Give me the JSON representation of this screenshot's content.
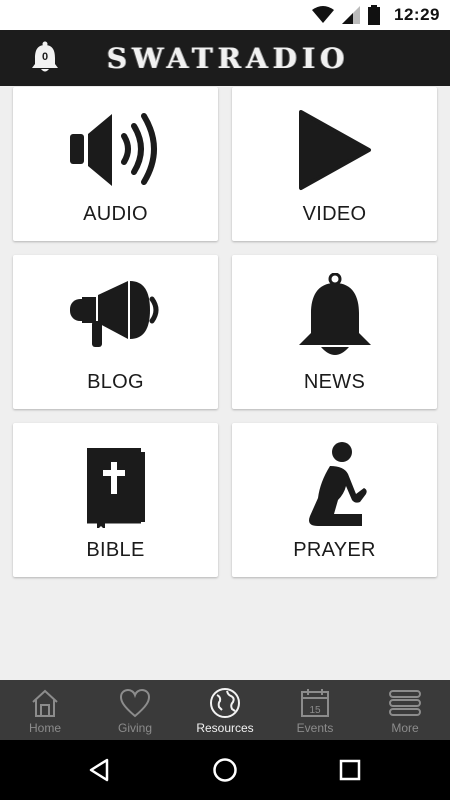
{
  "status_bar": {
    "time": "12:29"
  },
  "header": {
    "notification_count": "0",
    "brand": "SWATRADIO"
  },
  "tiles": [
    {
      "label": "AUDIO",
      "icon": "speaker-icon"
    },
    {
      "label": "VIDEO",
      "icon": "play-icon"
    },
    {
      "label": "BLOG",
      "icon": "megaphone-icon"
    },
    {
      "label": "NEWS",
      "icon": "bell-icon"
    },
    {
      "label": "BIBLE",
      "icon": "bible-icon"
    },
    {
      "label": "PRAYER",
      "icon": "praying-person-icon"
    }
  ],
  "tabs": [
    {
      "label": "Home",
      "icon": "home-icon",
      "active": false
    },
    {
      "label": "Giving",
      "icon": "heart-icon",
      "active": false
    },
    {
      "label": "Resources",
      "icon": "globe-icon",
      "active": true
    },
    {
      "label": "Events",
      "icon": "calendar-icon",
      "active": false,
      "calendar_day": "15"
    },
    {
      "label": "More",
      "icon": "menu-icon",
      "active": false
    }
  ],
  "colors": {
    "header_bg": "#1c1c1c",
    "tab_bar_bg": "#3a3a3a",
    "page_bg": "#efefef",
    "tile_bg": "#ffffff"
  }
}
